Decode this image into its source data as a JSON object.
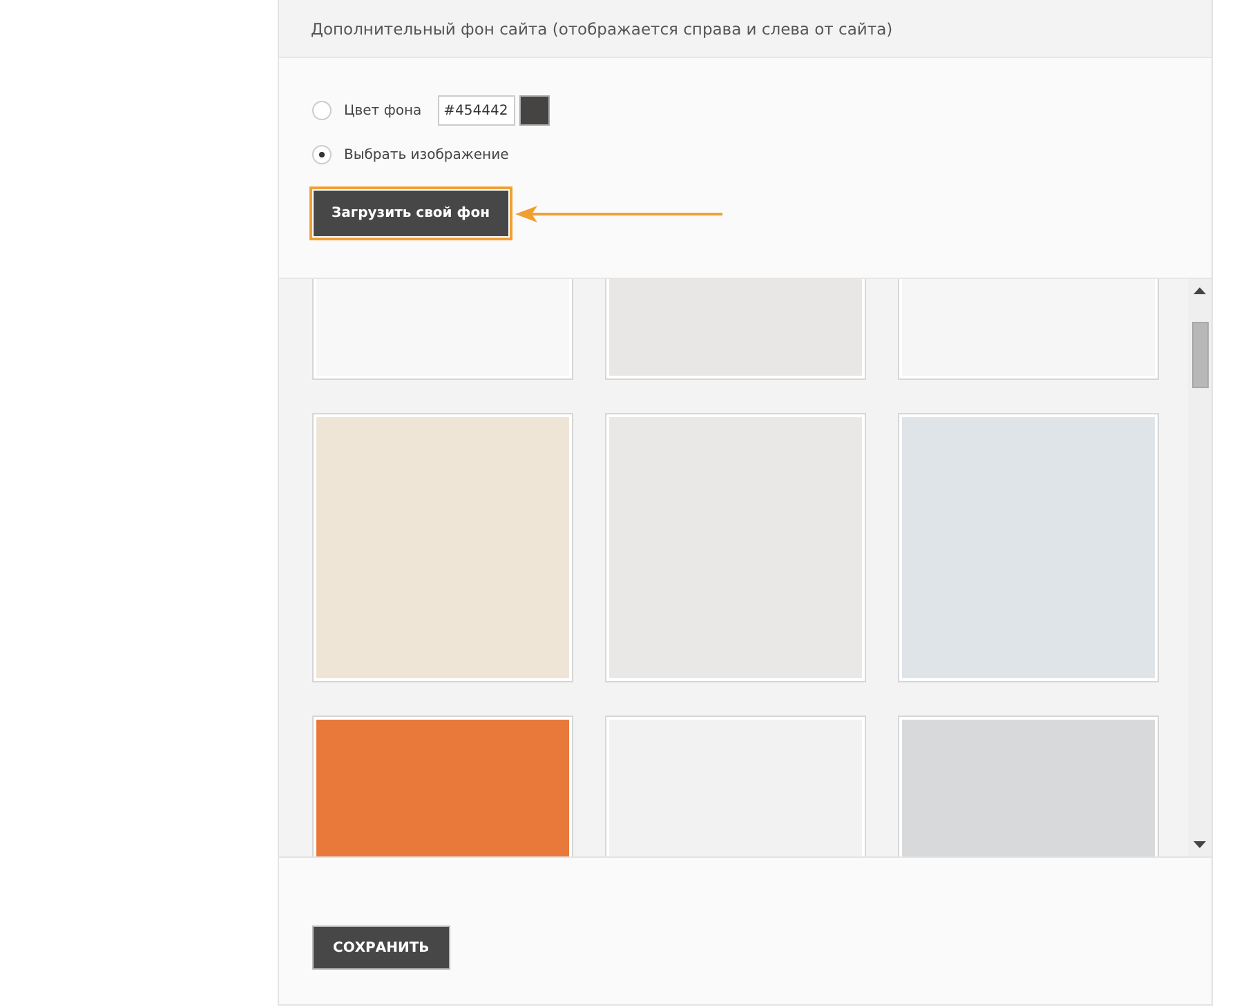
{
  "header": {
    "title": "Дополнительный фон сайта (отображается справа и слева от сайта)"
  },
  "options": [
    {
      "kind": "color",
      "label": "Цвет фона",
      "selected": false,
      "value": "#454442",
      "color": "#454442"
    },
    {
      "kind": "image",
      "label": "Выбрать изображение",
      "selected": true
    }
  ],
  "upload_button": {
    "label": "Загрузить свой фон",
    "highlighted": true
  },
  "textures": [
    {
      "color": "#f8f8f8"
    },
    {
      "color": "#e8e7e5"
    },
    {
      "color": "#f6f6f6"
    },
    {
      "color": "#eee5d7"
    },
    {
      "color": "#e9e8e6"
    },
    {
      "color": "#dfe4e9"
    },
    {
      "color": "#e8793a"
    },
    {
      "color": "#f2f2f2"
    },
    {
      "color": "#d8d9db"
    }
  ],
  "save_button": {
    "label": "СОХРАНИТЬ"
  }
}
